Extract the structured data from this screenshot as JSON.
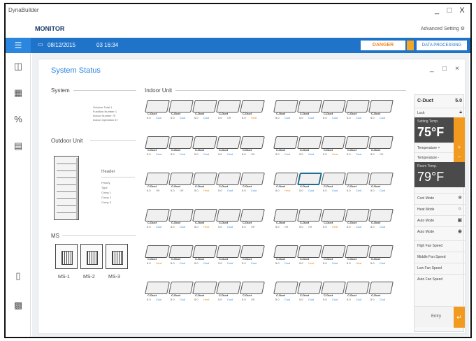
{
  "app": {
    "title": "DynaBuilder",
    "module": "MONITOR",
    "advanced_setting": "Advanced Setting",
    "min_icon": "_",
    "max_icon": "□",
    "close_icon": "X"
  },
  "topbar": {
    "date": "08/12/2015",
    "time": "03 16:34",
    "danger_label": "DANGER",
    "data_label": "DATA PROCESSING"
  },
  "panel": {
    "title": "System Status",
    "sections": {
      "system": "System",
      "outdoor": "Outdoor Unit",
      "ms": "MS",
      "indoor": "Indoor Unit"
    },
    "system_info": [
      {
        "label": "Outdoor Total",
        "value": "1"
      },
      {
        "label": "Function Number",
        "value": "1"
      },
      {
        "label": "Indoor Number",
        "value": "70"
      },
      {
        "label": "Indoor Operation",
        "value": "37"
      }
    ],
    "outdoor_info": {
      "header": "Header",
      "rows": [
        "Priority",
        "Type",
        "Comp 1",
        "Comp 2",
        "Comp 3"
      ]
    },
    "ms_units": [
      "MS-1",
      "MS-2",
      "MS-3"
    ]
  },
  "indoor_units": {
    "name": "C-Duct",
    "temp": "5.0",
    "modes": [
      "Cool",
      "Cool",
      "Cool",
      "Off",
      "Heat",
      "Cool",
      "Cool",
      "Cool",
      "Cool",
      "Cool",
      "Cool",
      "Cool",
      "Cool",
      "Cool",
      "Off",
      "Cool",
      "Cool",
      "Heat",
      "Cool",
      "Off",
      "Off",
      "Off",
      "Heat",
      "Cool",
      "Cool",
      "Heat",
      "Cool",
      "Cool",
      "Cool",
      "Cool",
      "Cool",
      "Cool",
      "Heat",
      "Cool",
      "Off",
      "Off",
      "Off",
      "Heat",
      "Cool",
      "Cool",
      "Heat",
      "Cool",
      "Cool",
      "Cool",
      "Cool",
      "Cool",
      "Heat",
      "Cool",
      "Heat",
      "Cool",
      "Cool",
      "Cool",
      "Heat",
      "Cool",
      "Off",
      "Cool",
      "Cool",
      "Cool",
      "Cool",
      "Cool"
    ]
  },
  "right_panel": {
    "unit_name": "C-Duct",
    "unit_temp": "5.0",
    "lock_label": "Lock",
    "setting_temp_label": "Setting Temp.",
    "setting_temp": "75°F",
    "temp_up": "Temperature +",
    "temp_down": "Temperature -",
    "room_temp_label": "Room Temp.",
    "room_temp": "79°F",
    "modes": [
      "Cool Mode",
      "Heat Mode",
      "Auto Mode",
      "Auto Mode"
    ],
    "fan_speeds": [
      "High Fan Speed",
      "Middle Fan Speed",
      "Low Fan Speed",
      "Auto Fan Speed"
    ],
    "enter_label": "Entry"
  }
}
